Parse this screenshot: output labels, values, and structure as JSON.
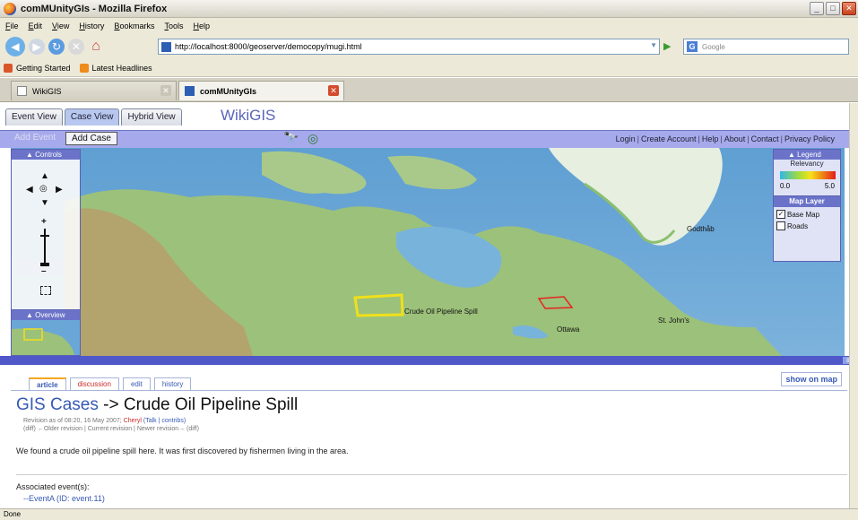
{
  "window": {
    "title": "comMUnityGIs - Mozilla Firefox"
  },
  "menu": [
    "File",
    "Edit",
    "View",
    "History",
    "Bookmarks",
    "Tools",
    "Help"
  ],
  "navbar": {
    "url": "http://localhost:8000/geoserver/democopy/mugi.html",
    "search_placeholder": "Google"
  },
  "bookmarks": {
    "getting_started": "Getting Started",
    "latest_headlines": "Latest Headlines"
  },
  "tabs": [
    {
      "label": "WikiGIS"
    },
    {
      "label": "comMUnityGIs"
    }
  ],
  "app": {
    "view_tabs": [
      "Event View",
      "Case View",
      "Hybrid View"
    ],
    "brand": "WikiGIS",
    "add_event": "Add Event",
    "add_case": "Add Case",
    "links": [
      "Login",
      "Create Account",
      "Help",
      "About",
      "Contact",
      "Privacy Policy"
    ]
  },
  "map": {
    "controls_title": "Controls",
    "overview_title": "Overview",
    "legend": {
      "title": "Legend",
      "subtitle": "Relevancy",
      "min": "0.0",
      "max": "5.0"
    },
    "layers": {
      "title": "Map Layer",
      "items": [
        {
          "label": "Base Map",
          "checked": true
        },
        {
          "label": "Roads",
          "checked": false
        }
      ]
    },
    "labels": {
      "spill": "Crude Oil Pipeline Spill",
      "ottawa": "Ottawa",
      "stjohns": "St. John's",
      "godthab": "Godthåb"
    }
  },
  "wiki": {
    "tabs": [
      "article",
      "discussion",
      "edit",
      "history"
    ],
    "show_on_map": "show on map",
    "category": "GIS Cases",
    "arrow": "->",
    "title": "Crude Oil Pipeline Spill",
    "rev_prefix": "Revision as of 08:20, 16 May 2007; ",
    "rev_user": "Cheryl",
    "rev_talk": "(Talk | contribs)",
    "rev_line2": "(diff) ←Older revision | Current revision | Newer revision→ (diff)",
    "body": "We found a crude oil pipeline spill here. It was first discovered by fishermen living in the area.",
    "assoc_label": "Associated event(s):",
    "assoc_item": "--EventA (ID: event.11)"
  },
  "status": "Done",
  "colors": {
    "accent": "#a6aaec",
    "panel": "#6b73c9",
    "link": "#3759b5"
  }
}
